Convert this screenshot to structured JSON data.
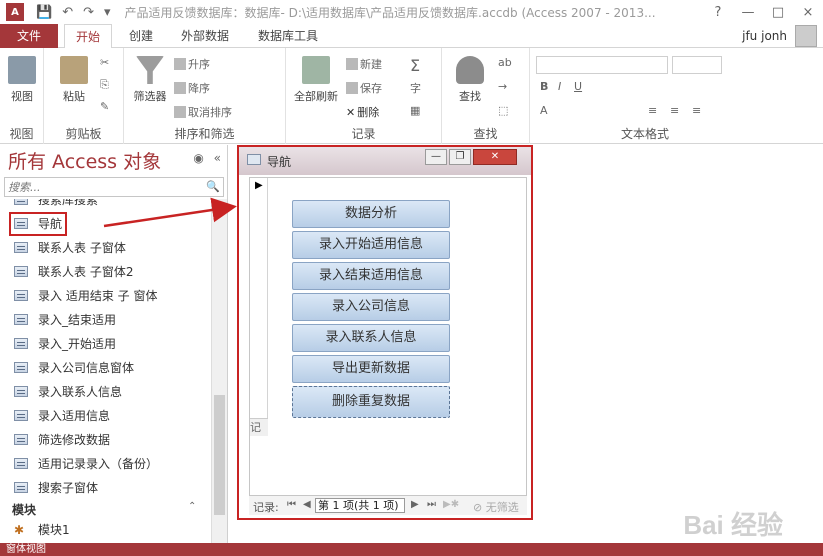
{
  "window": {
    "app_logo": "A",
    "title": "产品适用反馈数据库：数据库- D:\\适用数据库\\产品适用反馈数据库.accdb (Access 2007 - 2013...",
    "controls": [
      "?",
      "—",
      "□",
      "×"
    ]
  },
  "qat": {
    "save": "💾",
    "undo": "↶",
    "redo": "↷",
    "more": "▾"
  },
  "tabs": [
    "文件",
    "开始",
    "创建",
    "外部数据",
    "数据库工具"
  ],
  "active_tab": "开始",
  "user": "jfu jonh",
  "ribbon": {
    "groups": {
      "view": "视图",
      "clipboard": "剪贴板",
      "sort_filter": "排序和筛选",
      "records": "记录",
      "find": "查找",
      "text_format": "文本格式"
    },
    "buttons": {
      "view": "视图",
      "paste": "粘贴",
      "filter": "筛选器",
      "asc": "升序",
      "desc": "降序",
      "clear_sort": "取消排序",
      "refresh_all": "全部刷新",
      "new": "新建",
      "save": "保存",
      "delete": "删除",
      "find": "查找"
    }
  },
  "nav": {
    "header": "所有 Access 对象",
    "search_placeholder": "搜索...",
    "items": [
      "搜索库搜索",
      "导航",
      "联系人表 子窗体",
      "联系人表 子窗体2",
      "录入 适用结束 子 窗体",
      "录入_结束适用",
      "录入_开始适用",
      "录入公司信息窗体",
      "录入联系人信息",
      "录入适用信息",
      "筛选修改数据",
      "适用记录录入（备份）",
      "搜索子窗体"
    ],
    "selected": "导航",
    "module_section": "模块",
    "module_items": [
      "模块1"
    ]
  },
  "form": {
    "title": "导航",
    "buttons": [
      "数据分析",
      "录入开始适用信息",
      "录入结束适用信息",
      "录入公司信息",
      "录入联系人信息",
      "导出更新数据",
      "删除重复数据"
    ],
    "record_label": "记录:",
    "record_position": "第 1 项(共 1 项)",
    "no_filter": "无筛选",
    "left_record_label": "记"
  },
  "statusbar": "窗体视图",
  "watermark": "Bai 经验",
  "colors": {
    "accent": "#a4373a",
    "annotation": "#c82323"
  }
}
